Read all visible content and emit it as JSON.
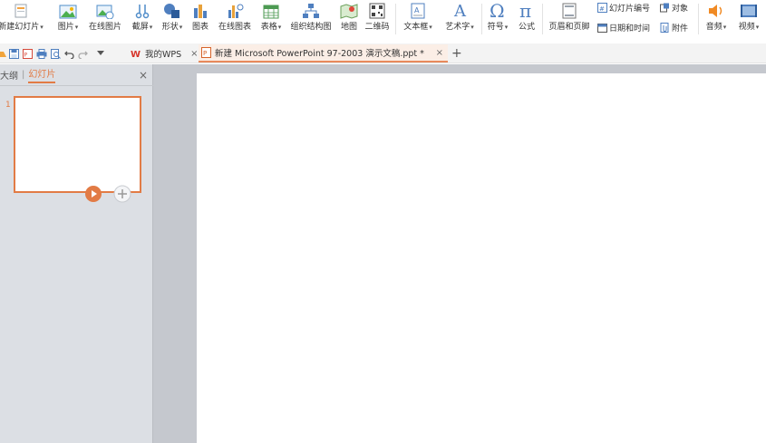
{
  "ribbon": {
    "new_slide": "新建幻灯片",
    "picture": "图片",
    "online_picture": "在线图片",
    "screenshot": "截屏",
    "shapes": "形状",
    "chart": "图表",
    "online_chart": "在线图表",
    "table": "表格",
    "smartart": "组织结构图",
    "map": "地图",
    "qrcode": "二维码",
    "textbox": "文本框",
    "wordart": "艺术字",
    "symbol": "符号",
    "formula": "公式",
    "header_footer": "页眉和页脚",
    "slide_number": "幻灯片编号",
    "object": "对象",
    "date_time": "日期和时间",
    "attachment": "附件",
    "audio": "音频",
    "video": "视频",
    "dropdown_glyph": "▾"
  },
  "tabs": {
    "wps_home": "我的WPS",
    "document": "新建 Microsoft PowerPoint 97-2003 演示文稿.ppt *",
    "close_glyph": "×",
    "new_tab_glyph": "+"
  },
  "panel": {
    "outline_tab": "大纲",
    "separator": "|",
    "slides_tab": "幻灯片",
    "close_glyph": "×",
    "slide_number": "1"
  },
  "colors": {
    "accent": "#e27b45",
    "panel_bg": "#dcdfe4",
    "workspace_bg": "#c5c8ce"
  }
}
